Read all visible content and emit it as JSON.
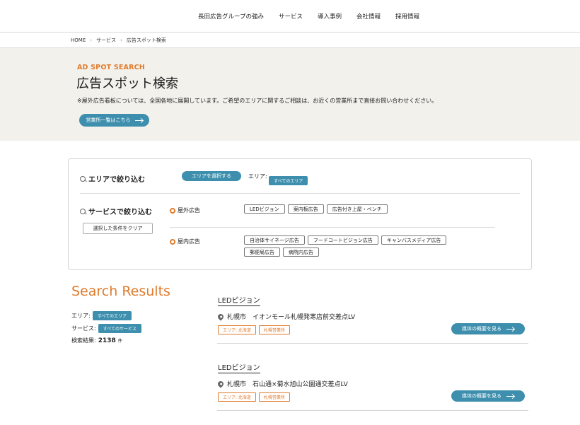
{
  "nav": {
    "items": [
      "長田広告グループの強み",
      "サービス",
      "導入事例",
      "会社情報",
      "採用情報"
    ]
  },
  "breadcrumb": [
    "HOME",
    "サービス",
    "広告スポット検索"
  ],
  "hero": {
    "subtitle": "AD SPOT SEARCH",
    "title": "広告スポット検索",
    "note": "※屋外広告看板については、全国各地に展開しています。ご希望のエリアに関するご相談は、お近くの営業所まで直接お問い合わせください。",
    "button_label": "営業所一覧はこちら"
  },
  "filter": {
    "area_heading": "エリアで絞り込む",
    "area_select_label": "エリアを選択する",
    "area_label": "エリア:",
    "area_value": "すべてのエリア",
    "service_heading": "サービスで絞り込む",
    "clear_label": "選択した条件をクリア",
    "categories": [
      {
        "label": "屋外広告",
        "chips": [
          "LEDビジョン",
          "案内板広告",
          "広告付き上屋・ベンチ"
        ]
      },
      {
        "label": "屋内広告",
        "chips": [
          "自治体サイネージ広告",
          "フードコートビジョン広告",
          "キャンバスメディア広告",
          "郵便局広告",
          "病院内広告"
        ]
      }
    ]
  },
  "results": {
    "title": "Search Results",
    "area_label": "エリア:",
    "area_value": "すべてのエリア",
    "service_label": "サービス:",
    "service_value": "すべてのサービス",
    "count_label": "検索結果:",
    "count_value": "2138",
    "count_unit": "件",
    "items": [
      {
        "category": "LEDビジョン",
        "location": "札幌市　イオンモール札幌発寒店前交差点LV",
        "tags": [
          "エリア: 北海道",
          "札幌営業所"
        ],
        "button_label": "媒体の概要を見る"
      },
      {
        "category": "LEDビジョン",
        "location": "札幌市　石山通×菊水旭山公園通交差点LV",
        "tags": [
          "エリア: 北海道",
          "札幌営業所"
        ],
        "button_label": "媒体の概要を見る"
      }
    ]
  },
  "colors": {
    "accent": "#e07b2c",
    "button": "#3e8fae",
    "hero_bg": "#f3f1ec"
  }
}
